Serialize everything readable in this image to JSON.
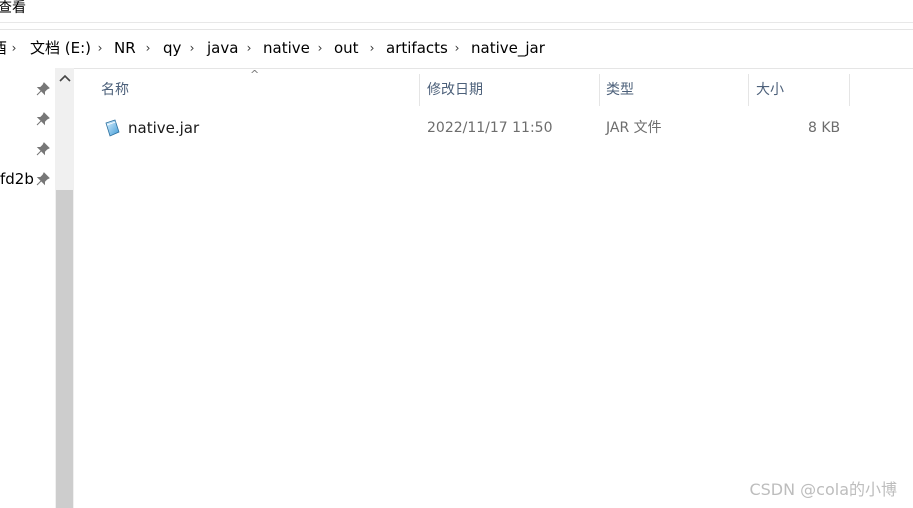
{
  "menu": {
    "view_label": "查看"
  },
  "breadcrumb": {
    "items": [
      "文档 (E:)",
      "NR",
      "qy",
      "java",
      "native",
      "out",
      "artifacts",
      "native_jar"
    ],
    "lead_fragment": "酉"
  },
  "nav": {
    "items": [
      {
        "label": "",
        "pinned": true
      },
      {
        "label": "",
        "pinned": true
      },
      {
        "label": "",
        "pinned": true
      },
      {
        "label": "fd2b",
        "pinned": true
      }
    ]
  },
  "columns": {
    "name": "名称",
    "date_modified": "修改日期",
    "type": "类型",
    "size": "大小"
  },
  "files": [
    {
      "name": "native.jar",
      "date_modified": "2022/11/17 11:50",
      "type": "JAR 文件",
      "size": "8 KB",
      "icon": "jar-file-icon"
    }
  ],
  "watermark": "CSDN @cola的小博"
}
